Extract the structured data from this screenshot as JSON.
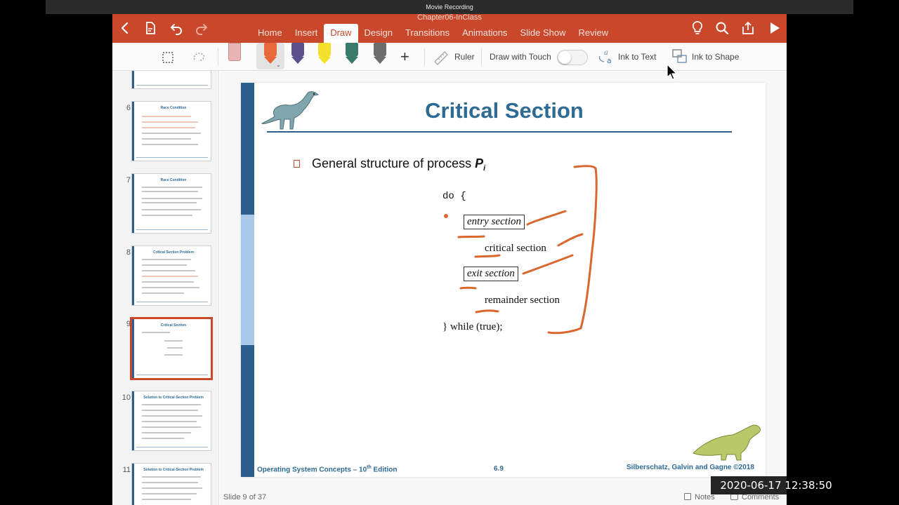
{
  "recording": {
    "title": "Movie Recording"
  },
  "document": {
    "title": "Chapter06-InClass"
  },
  "ribbon": {
    "tabs": [
      "Home",
      "Insert",
      "Draw",
      "Design",
      "Transitions",
      "Animations",
      "Slide Show",
      "Review"
    ],
    "active_tab": "Draw"
  },
  "draw_toolbar": {
    "ruler_label": "Ruler",
    "draw_with_touch_label": "Draw with Touch",
    "ink_to_text_label": "Ink to Text",
    "ink_to_shape_label": "Ink to Shape",
    "pen_colors": [
      "#e8683a",
      "#5b4f8c",
      "#f2e02a",
      "#3a7a6a",
      "#6d6d6d"
    ]
  },
  "thumbnails": [
    {
      "number": "6",
      "title": "Race Condition"
    },
    {
      "number": "7",
      "title": "Race Condition"
    },
    {
      "number": "8",
      "title": "Critical Section Problem"
    },
    {
      "number": "9",
      "title": "Critical Section"
    },
    {
      "number": "10",
      "title": "Solution to Critical-Section Problem"
    },
    {
      "number": "11",
      "title": "Solution to Critical-Section Problem"
    }
  ],
  "slide": {
    "title": "Critical Section",
    "bullet": "General structure of process ",
    "bullet_var": "P",
    "bullet_sub": "i",
    "code": {
      "do": "do {",
      "entry": "entry section",
      "critical": "critical section",
      "exit": "exit section",
      "remainder": "remainder section",
      "end": "} while (true);"
    },
    "footer_left": "Operating System Concepts – 10",
    "footer_left_sup": "th",
    "footer_left_end": " Edition",
    "footer_mid": "6.9",
    "footer_right": "Silberschatz, Galvin and Gagne ©2018"
  },
  "status": {
    "slide_count": "Slide 9 of 37",
    "notes_label": "Notes",
    "comments_label": "Comments"
  },
  "timestamp": "2020-06-17 12:38:50",
  "colors": {
    "accent": "#c9472a",
    "slide_blue": "#2e6b94",
    "ink": "#d9672e"
  }
}
